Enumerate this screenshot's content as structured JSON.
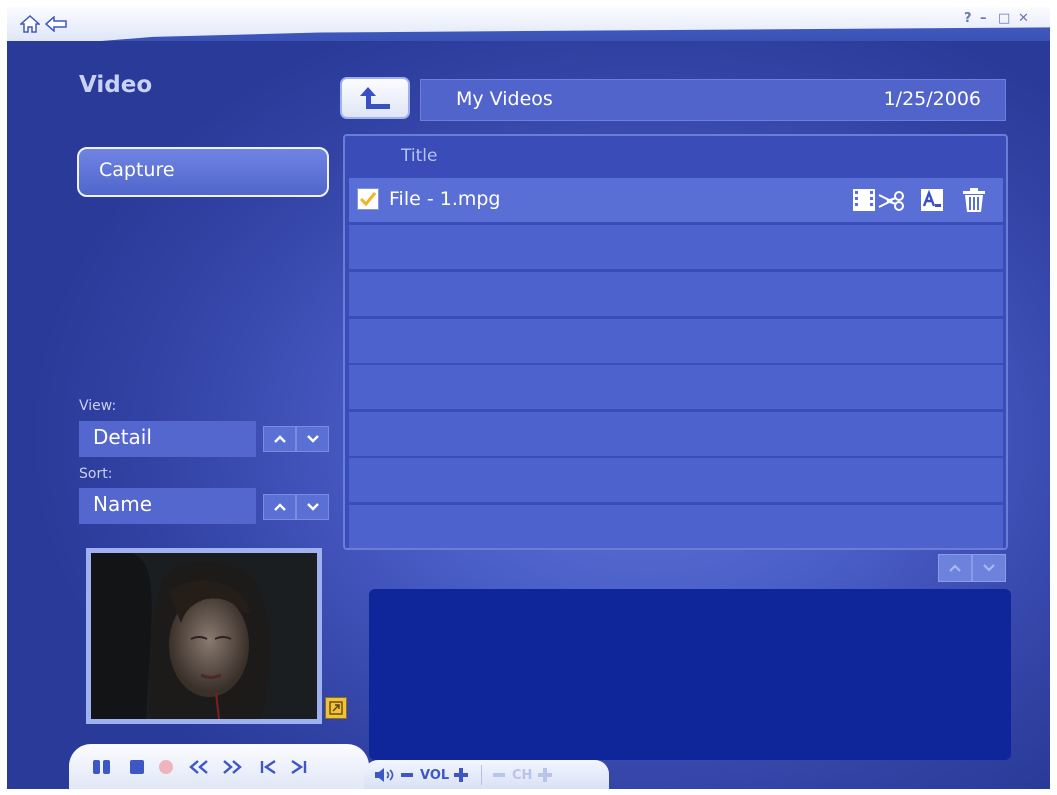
{
  "header": {
    "icons": [
      "home-icon",
      "back-icon"
    ],
    "window_controls": {
      "help": "?",
      "minimize": "–",
      "maximize": "□",
      "close": "✕"
    }
  },
  "section": {
    "title": "Video"
  },
  "sidebar": {
    "capture_label": "Capture",
    "view_label": "View:",
    "view_value": "Detail",
    "sort_label": "Sort:",
    "sort_value": "Name"
  },
  "path": {
    "folder": "My Videos",
    "date": "1/25/2006"
  },
  "filelist": {
    "column_title": "Title",
    "files": [
      {
        "name": "File - 1.mpg",
        "checked": true
      }
    ]
  },
  "transport": {
    "vol_label": "VOL",
    "ch_label": "CH"
  },
  "colors": {
    "background": "#4a5ec8",
    "panel_dark": "#0f259a",
    "accent_yellow": "#f0c23c"
  }
}
